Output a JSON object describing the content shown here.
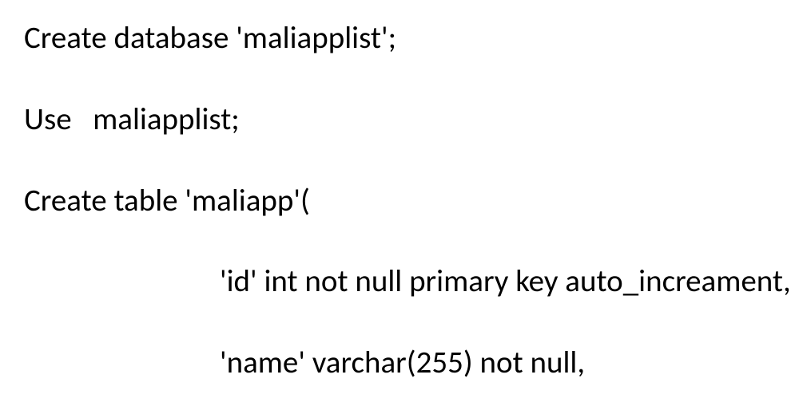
{
  "code": {
    "line1": "Create database 'maliapplist';",
    "line2": "Use   maliapplist;",
    "line3": "Create table 'maliapp'(",
    "line4": "'id' int not null primary key auto_increament,",
    "line5": "'name' varchar(255) not null,"
  }
}
